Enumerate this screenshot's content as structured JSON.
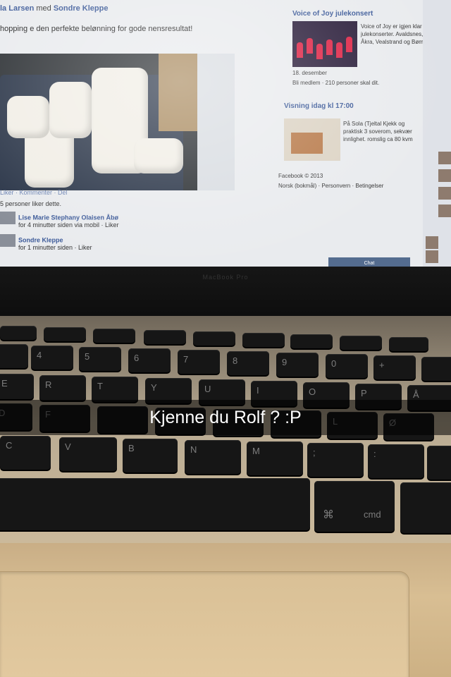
{
  "facebook": {
    "post_author": "la Larsen",
    "post_with_word": "med",
    "post_with_name": "Sondre Kleppe",
    "post_text": "hopping e den perfekte belønning for gode nensresultat!",
    "post_actions": "Liker · Kommenter · Del",
    "likes_line": "5 personer liker dette.",
    "comment_1_name": "Lise Marie Stephany Olaisen Åbø",
    "comment_1_meta": "for 4 minutter siden via mobil · Liker",
    "comment_2_name": "Sondre Kleppe",
    "comment_2_meta": "for 1 minutter siden · Liker",
    "event_1_title": "Voice of Joy julekonsert",
    "event_1_text": "Voice of Joy er igjen klar for julekonserter. Avaldsnes, Åkra, Vealstrand og Bømlo",
    "event_1_date": "18. desember",
    "event_1_stats": "Bli medlem · 210 personer skal dit.",
    "event_2_title": "Visning idag kl 17:00",
    "event_2_text": "På Sola (Tjeltal Kjekk og praktisk 3 soverom, sekvær innlighet. romslig ca 80 kvm",
    "footer_1": "Facebook © 2013",
    "footer_2": "Norsk (bokmål) · Personvern · Betingelser",
    "chat_label": "Chat"
  },
  "laptop": {
    "bezel_label": "MacBook Pro"
  },
  "keyboard": {
    "row_numbers": [
      "4",
      "5",
      "6",
      "7",
      "8",
      "9",
      "0",
      "+"
    ],
    "row_top": [
      "E",
      "R",
      "T",
      "Y",
      "U",
      "I",
      "O",
      "P",
      "Å"
    ],
    "row_home": [
      "D",
      "F",
      "",
      "",
      "",
      "",
      "L",
      "Ø"
    ],
    "row_bottom": [
      "C",
      "V",
      "B",
      "N",
      "M",
      ";",
      ":",
      ""
    ],
    "cmd_symbol": "⌘",
    "cmd_label": "cmd"
  },
  "caption": {
    "text": "Kjenne du Rolf ? :P"
  }
}
